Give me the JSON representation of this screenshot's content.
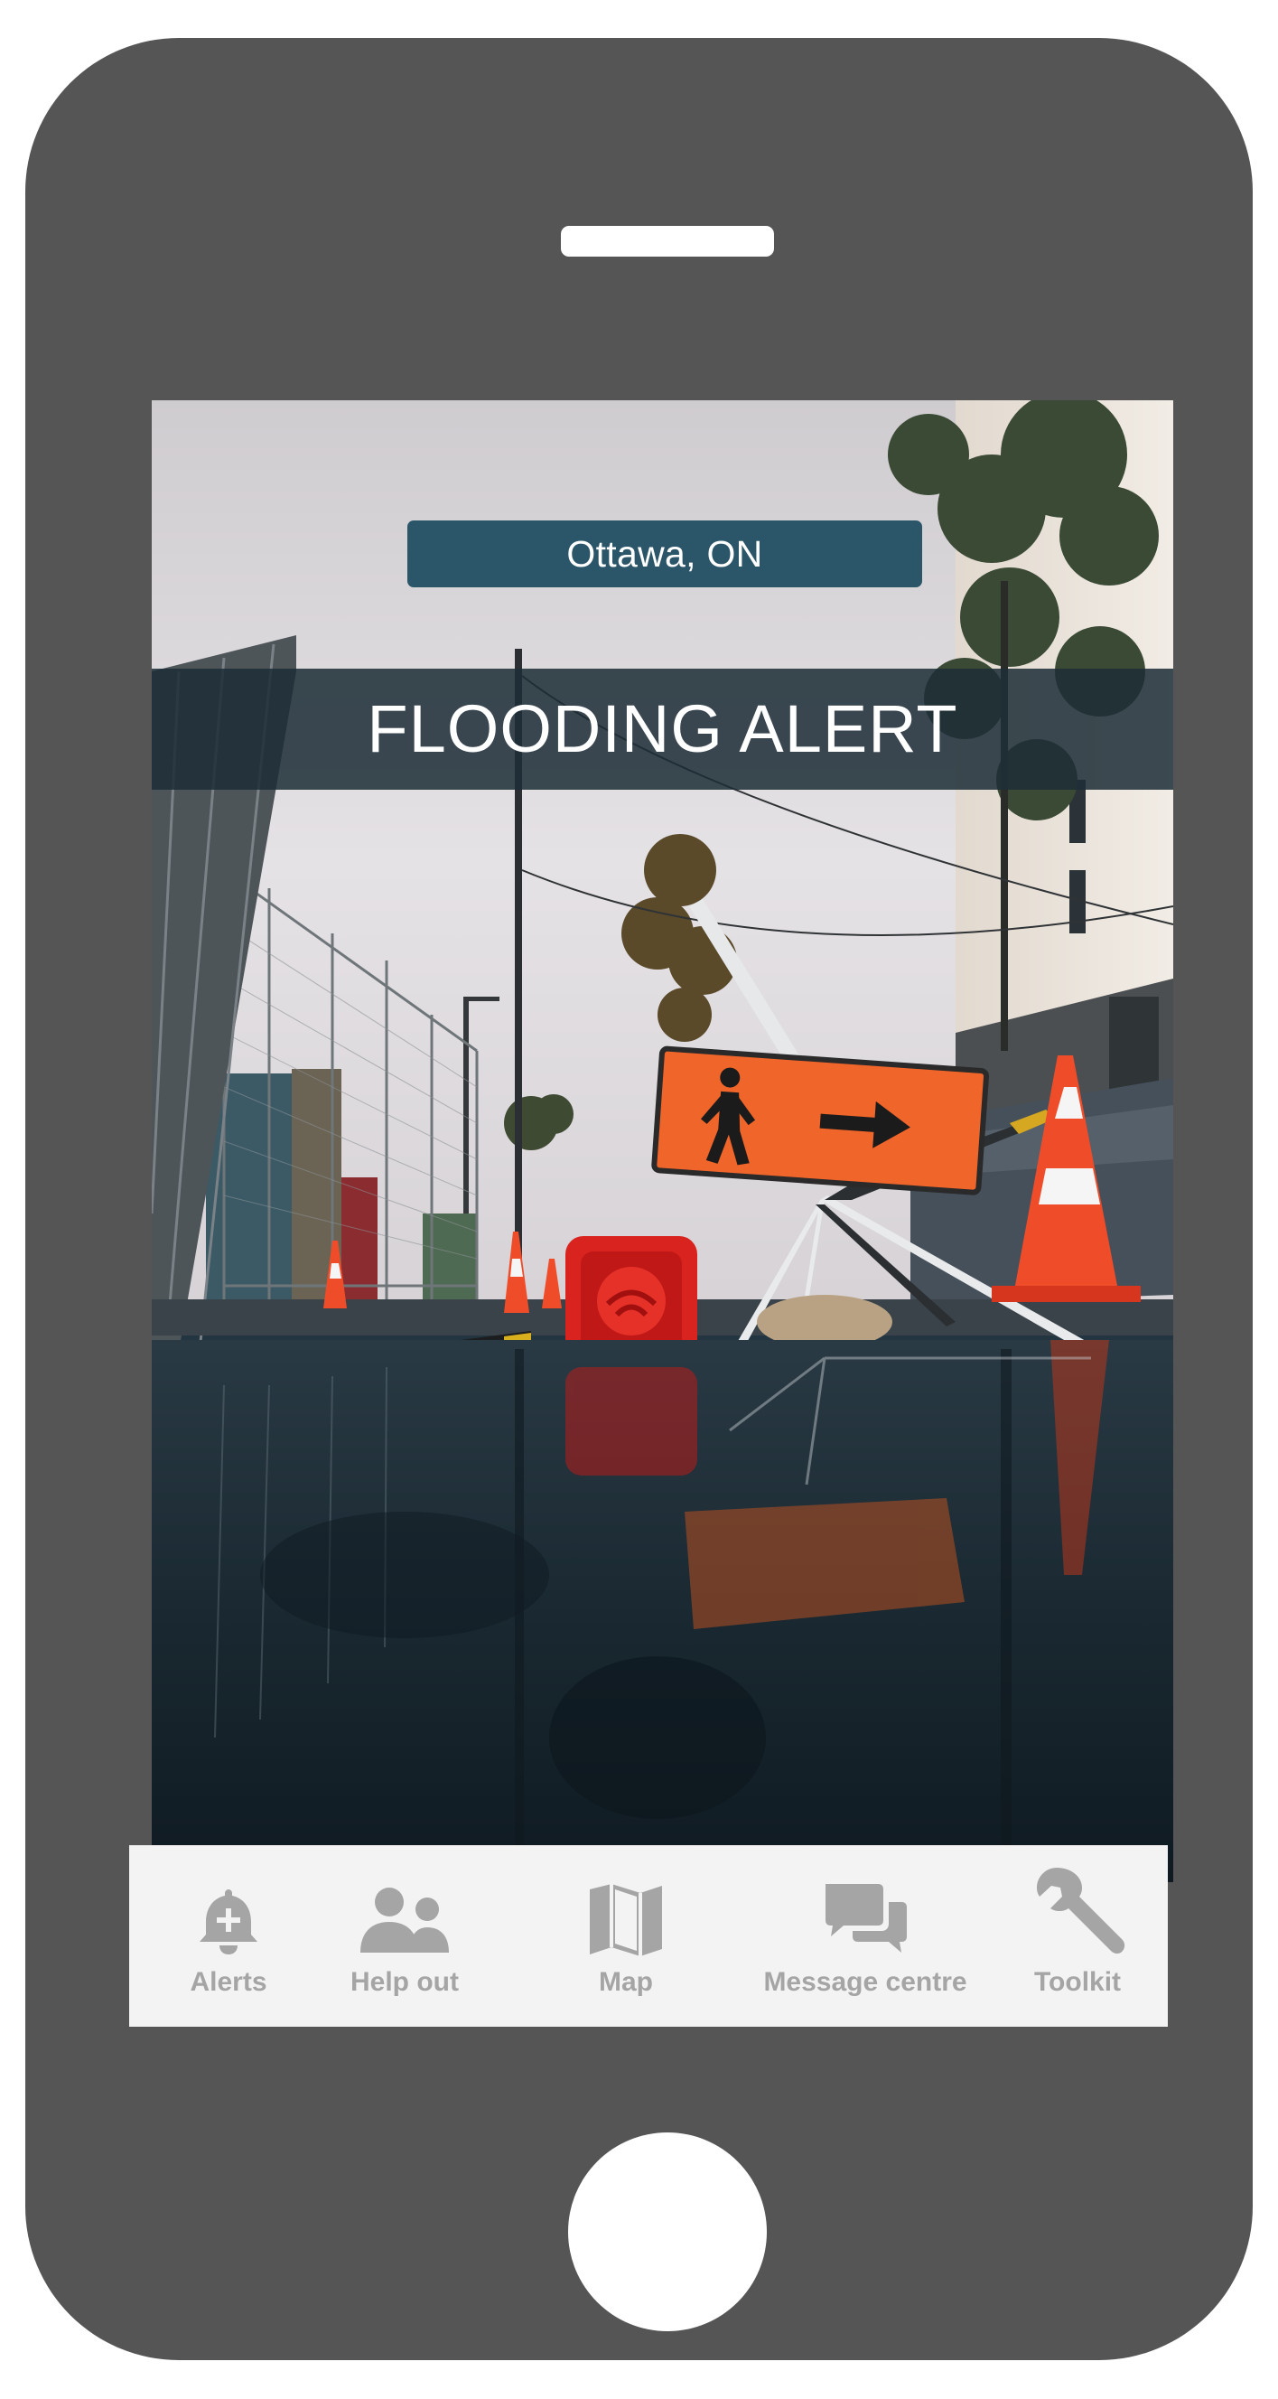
{
  "header": {
    "location": "Ottawa, ON",
    "alert_title": "FLOODING ALERT"
  },
  "hero_image": {
    "subject": "flooded street with orange pedestrian detour sign, traffic cones and barrier reflected in water"
  },
  "tabbar": {
    "items": [
      {
        "label": "Alerts",
        "icon": "bell-plus-icon"
      },
      {
        "label": "Help out",
        "icon": "people-icon"
      },
      {
        "label": "Map",
        "icon": "map-icon"
      },
      {
        "label": "Message centre",
        "icon": "chat-icon"
      },
      {
        "label": "Toolkit",
        "icon": "wrench-icon"
      }
    ]
  },
  "colors": {
    "device_body": "#555555",
    "location_chip": "#2b5568",
    "alert_banner": "#1d2d37",
    "tabbar_background": "#f3f3f3",
    "tab_icon": "#a5a5a5"
  }
}
